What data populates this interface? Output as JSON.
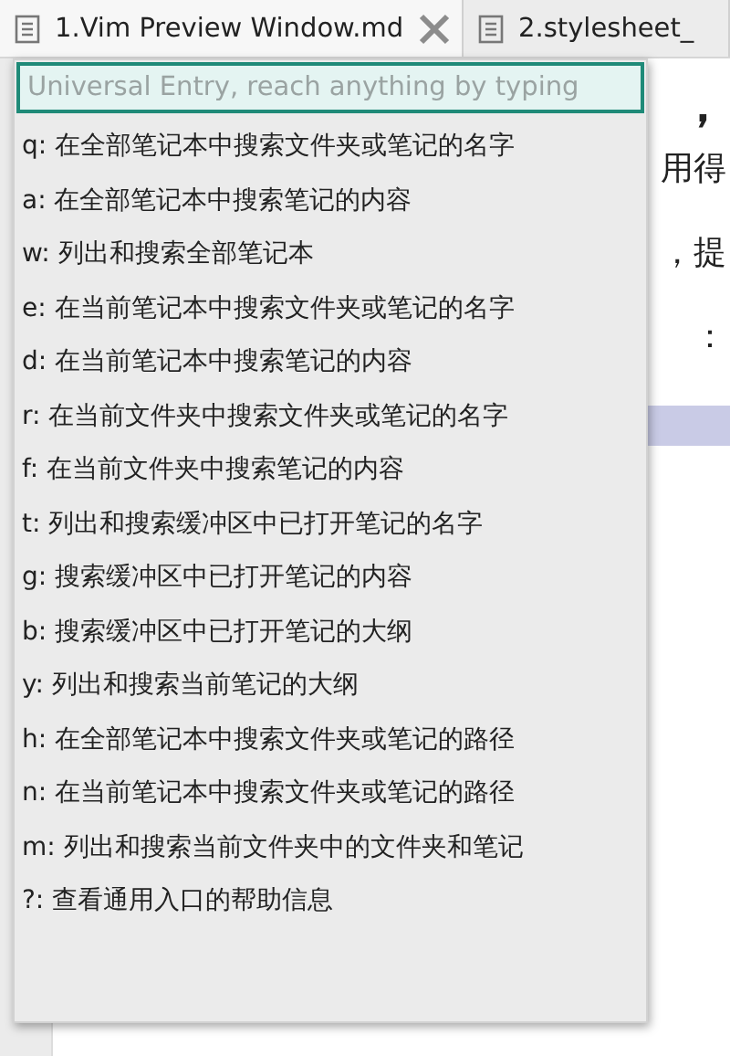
{
  "tabs": [
    {
      "title": "1.Vim Preview Window.md",
      "selected": true,
      "closable": true
    },
    {
      "title": "2.stylesheet_",
      "selected": false,
      "closable": false
    }
  ],
  "editor": {
    "lines": [
      {
        "text": "，",
        "kind": "heading"
      },
      {
        "text": "用得",
        "kind": "body"
      },
      {
        "text": "，提",
        "kind": "body"
      },
      {
        "text": "：",
        "kind": "body"
      },
      {
        "kind": "highlight"
      }
    ]
  },
  "universal_entry": {
    "placeholder": "Universal Entry, reach anything by typing",
    "items": [
      "q: 在全部笔记本中搜索文件夹或笔记的名字",
      "a: 在全部笔记本中搜索笔记的内容",
      "w: 列出和搜索全部笔记本",
      "e: 在当前笔记本中搜索文件夹或笔记的名字",
      "d: 在当前笔记本中搜索笔记的内容",
      "r: 在当前文件夹中搜索文件夹或笔记的名字",
      "f: 在当前文件夹中搜索笔记的内容",
      "t: 列出和搜索缓冲区中已打开笔记的名字",
      "g: 搜索缓冲区中已打开笔记的内容",
      "b: 搜索缓冲区中已打开笔记的大纲",
      "y: 列出和搜索当前笔记的大纲",
      "h: 在全部笔记本中搜索文件夹或笔记的路径",
      "n: 在当前笔记本中搜索文件夹或笔记的路径",
      "m: 列出和搜索当前文件夹中的文件夹和笔记",
      "?: 查看通用入口的帮助信息"
    ]
  }
}
